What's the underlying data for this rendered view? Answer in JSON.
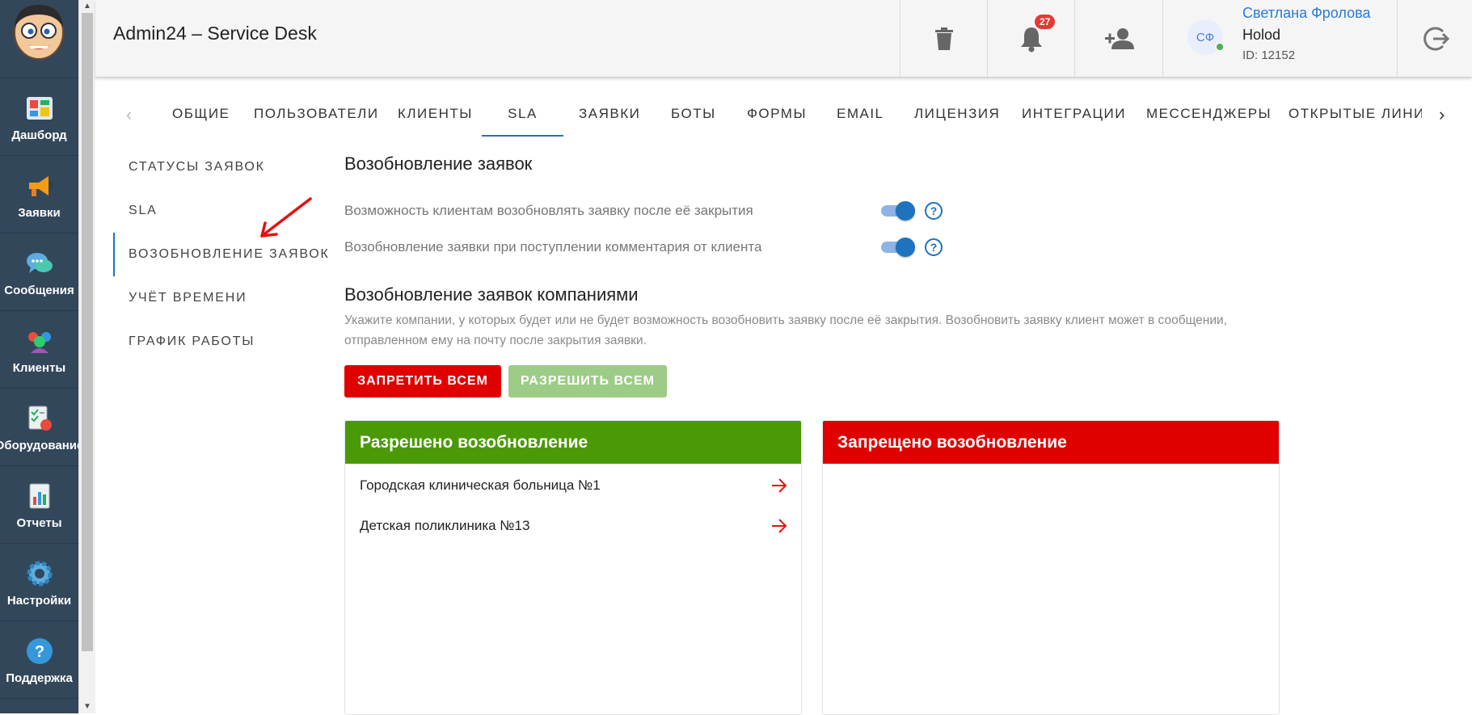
{
  "app": {
    "title": "Admin24 – Service Desk"
  },
  "nav": {
    "items": [
      {
        "id": "dashboard",
        "label": "Дашборд",
        "icon": "dashboard-icon"
      },
      {
        "id": "tickets",
        "label": "Заявки",
        "icon": "megaphone-icon"
      },
      {
        "id": "messages",
        "label": "Сообщения",
        "icon": "chat-icon"
      },
      {
        "id": "clients",
        "label": "Клиенты",
        "icon": "clients-icon"
      },
      {
        "id": "equipment",
        "label": "Оборудование",
        "icon": "equipment-icon"
      },
      {
        "id": "reports",
        "label": "Отчеты",
        "icon": "reports-icon"
      },
      {
        "id": "settings",
        "label": "Настройки",
        "icon": "gear-icon"
      },
      {
        "id": "support",
        "label": "Поддержка",
        "icon": "help-icon"
      }
    ]
  },
  "header": {
    "notifications_count": "27",
    "user": {
      "initials": "СФ",
      "name": "Светлана Фролова",
      "org": "Holod",
      "id_text": "ID: 12152"
    }
  },
  "tabs": [
    {
      "label": "Общие"
    },
    {
      "label": "Пользователи"
    },
    {
      "label": "Клиенты"
    },
    {
      "label": "SLA",
      "active": true
    },
    {
      "label": "Заявки"
    },
    {
      "label": "Боты"
    },
    {
      "label": "Формы"
    },
    {
      "label": "Email"
    },
    {
      "label": "Лицензия"
    },
    {
      "label": "Интеграции"
    },
    {
      "label": "Мессенджеры"
    },
    {
      "label": "Открытые линии"
    }
  ],
  "side_menu": [
    {
      "label": "Статусы заявок"
    },
    {
      "label": "SLA"
    },
    {
      "label": "Возобновление заявок",
      "active": true
    },
    {
      "label": "Учёт времени"
    },
    {
      "label": "График работы"
    }
  ],
  "content": {
    "section_title": "Возобновление заявок",
    "options": [
      {
        "label": "Возможность клиентам возобновлять заявку после её закрытия",
        "enabled": true
      },
      {
        "label": "Возобновление заявки при поступлении комментария от клиента",
        "enabled": true
      }
    ],
    "companies_title": "Возобновление заявок компаниями",
    "companies_desc": "Укажите компании, у которых будет или не будет возможность возобновить заявку после её закрытия. Возобновить заявку клиент может в сообщении, отправленном ему на почту после закрытия заявки.",
    "btn_deny_all": "Запретить всем",
    "btn_allow_all": "Разрешить всем",
    "allowed": {
      "title": "Разрешено возобновление",
      "items": [
        "Городская клиническая больница №1",
        "Детская поликлиника №13"
      ]
    },
    "denied": {
      "title": "Запрещено возобновление",
      "items": []
    }
  },
  "colors": {
    "rail": "#33475b",
    "accent": "#1e73be",
    "allowed_green": "#4a9a08",
    "denied_red": "#e10000",
    "btn_deny": "#e00000",
    "btn_allow": "#9ccc85"
  }
}
